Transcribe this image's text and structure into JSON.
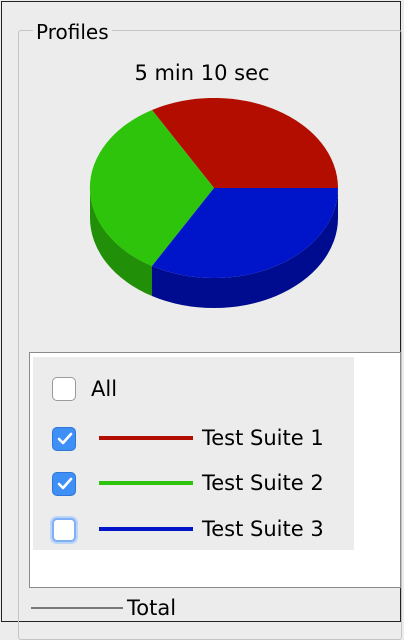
{
  "group": {
    "title": "Profiles"
  },
  "chart_data": {
    "type": "pie",
    "title": "5 min 10 sec",
    "series": [
      {
        "name": "Test Suite 1",
        "color": "#b30d00",
        "value": 33
      },
      {
        "name": "Test Suite 2",
        "color": "#2ec40c",
        "value": 33
      },
      {
        "name": "Test Suite 3",
        "color": "#0015c9",
        "value": 34
      }
    ]
  },
  "legend": {
    "all_label": "All",
    "all_checked": false,
    "items": [
      {
        "label": "Test Suite 1",
        "checked": true,
        "color": "#b30d00"
      },
      {
        "label": "Test Suite 2",
        "checked": true,
        "color": "#2ec40c"
      },
      {
        "label": "Test Suite 3",
        "checked": false,
        "color": "#0015c9"
      }
    ],
    "total_label": "Total",
    "total_color": "#777777"
  }
}
